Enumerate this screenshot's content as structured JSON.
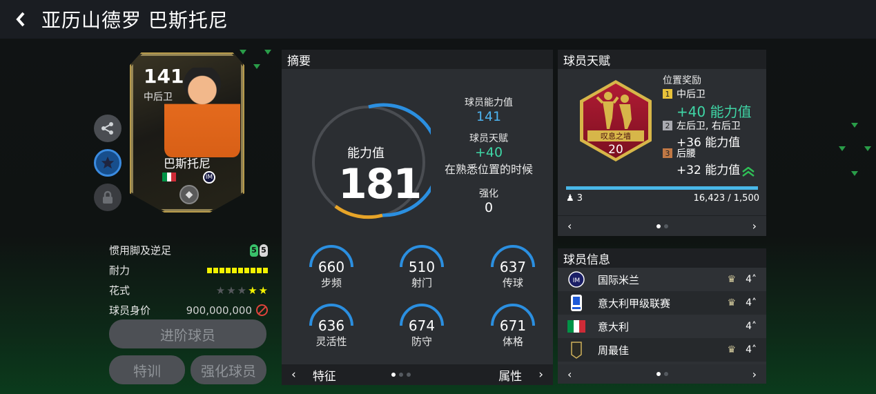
{
  "header": {
    "back_icon": "‹",
    "title": "亚历山德罗 巴斯托尼"
  },
  "card": {
    "rating": "141",
    "position": "中后卫",
    "name": "巴斯托尼",
    "flag_colors": [
      "#009246",
      "#ffffff",
      "#ce2b37"
    ],
    "club_badge": "IM"
  },
  "player_stats": {
    "foot_label": "惯用脚及逆足",
    "foot_strong": "5",
    "foot_weak": "5",
    "stamina_label": "耐力",
    "skill_label": "花式",
    "skill_stars_filled": 2,
    "skill_stars_total": 5,
    "price_label": "球员身价",
    "price_value": "900,000,000"
  },
  "buttons": {
    "advance": "进阶球员",
    "training": "特训",
    "enhance": "强化球员"
  },
  "summary": {
    "title": "摘要",
    "gauge_label": "能力值",
    "gauge_value": "181",
    "player_rating_label": "球员能力值",
    "player_rating_value": "141",
    "talent_label": "球员天赋",
    "talent_value": "+40",
    "talent_condition": "在熟悉位置的时候",
    "enhance_label": "强化",
    "enhance_value": "0",
    "sub_stats": [
      {
        "label": "步频",
        "value": "660"
      },
      {
        "label": "射门",
        "value": "510"
      },
      {
        "label": "传球",
        "value": "637"
      },
      {
        "label": "灵活性",
        "value": "636"
      },
      {
        "label": "防守",
        "value": "674"
      },
      {
        "label": "体格",
        "value": "671"
      }
    ],
    "nav_left": "特征",
    "nav_right": "属性"
  },
  "talent": {
    "title": "球员天赋",
    "badge_name": "叹息之墙",
    "badge_level": "20",
    "bonus_title": "位置奖励",
    "bonuses": [
      {
        "num": "1",
        "position": "中后卫",
        "value": "+40 能力值",
        "color": "#e8c23a"
      },
      {
        "num": "2",
        "position": "左后卫, 右后卫",
        "value": "+36 能力值",
        "color": "#a9aab0"
      },
      {
        "num": "3",
        "position": "后腰",
        "value": "+32 能力值",
        "color": "#c07845"
      }
    ],
    "progress_fraction": 1.0,
    "count": "3",
    "progress_text": "16,423 / 1,500"
  },
  "info": {
    "title": "球员信息",
    "rows": [
      {
        "name": "国际米兰",
        "rating": "4"
      },
      {
        "name": "意大利甲级联赛",
        "rating": "4"
      },
      {
        "name": "意大利",
        "rating": "4"
      },
      {
        "name": "周最佳",
        "rating": "4"
      }
    ]
  }
}
